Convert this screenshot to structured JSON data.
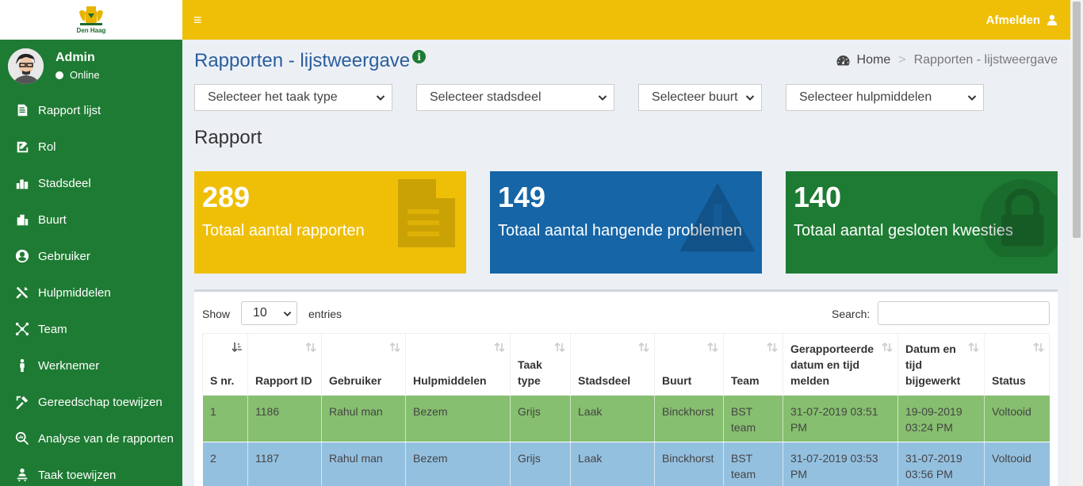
{
  "app": {
    "logo_text": "Den Haag",
    "user_name": "Admin",
    "user_status": "Online"
  },
  "sidebar": {
    "items": [
      {
        "label": "Rapport lijst",
        "icon": "document-icon"
      },
      {
        "label": "Rol",
        "icon": "edit-icon"
      },
      {
        "label": "Stadsdeel",
        "icon": "city-icon"
      },
      {
        "label": "Buurt",
        "icon": "building-icon"
      },
      {
        "label": "Gebruiker",
        "icon": "user-circle-icon"
      },
      {
        "label": "Hulpmiddelen",
        "icon": "tools-icon"
      },
      {
        "label": "Team",
        "icon": "team-icon"
      },
      {
        "label": "Werknemer",
        "icon": "worker-icon"
      },
      {
        "label": "Gereedschap toewijzen",
        "icon": "assign-tools-icon"
      },
      {
        "label": "Analyse van de rapporten",
        "icon": "analysis-icon"
      },
      {
        "label": "Taak toewijzen",
        "icon": "task-assign-icon"
      }
    ]
  },
  "header": {
    "menu_icon": "≡",
    "logout_label": "Afmelden"
  },
  "page": {
    "title": "Rapporten - lijstweergave",
    "info_icon": "i",
    "breadcrumb_home": "Home",
    "breadcrumb_sep": ">",
    "breadcrumb_current": "Rapporten - lijstweergave",
    "section_title": "Rapport"
  },
  "filters": {
    "task_type": "Selecteer het taak type",
    "district": "Selecteer stadsdeel",
    "neighbourhood": "Selecteer buurt",
    "tools": "Selecteer hulpmiddelen"
  },
  "stats": [
    {
      "value": "289",
      "label": "Totaal aantal rapporten",
      "color": "#efbf07",
      "icon": "file-icon"
    },
    {
      "value": "149",
      "label": "Totaal aantal hangende problemen",
      "color": "#1565a7",
      "icon": "warning-icon"
    },
    {
      "value": "140",
      "label": "Totaal aantal gesloten kwesties",
      "color": "#1e7b33",
      "icon": "lock-icon"
    }
  ],
  "table_controls": {
    "show_label": "Show",
    "entries_value": "10",
    "entries_label": "entries",
    "search_label": "Search:"
  },
  "table": {
    "columns": [
      "S nr.",
      "Rapport ID",
      "Gebruiker",
      "Hulpmiddelen",
      "Taak type",
      "Stadsdeel",
      "Buurt",
      "Team",
      "Gerapporteerde datum en tijd melden",
      "Datum en tijd bijgewerkt",
      "Status"
    ],
    "rows": [
      [
        "1",
        "1186",
        "Rahul man",
        "Bezem",
        "Grijs",
        "Laak",
        "Binckhorst",
        "BST team",
        "31-07-2019 03:51 PM",
        "19-09-2019 03:24 PM",
        "Voltooid"
      ],
      [
        "2",
        "1187",
        "Rahul man",
        "Bezem",
        "Grijs",
        "Laak",
        "Binckhorst",
        "BST team",
        "31-07-2019 03:53 PM",
        "31-07-2019 03:56 PM",
        "Voltooid"
      ]
    ]
  }
}
